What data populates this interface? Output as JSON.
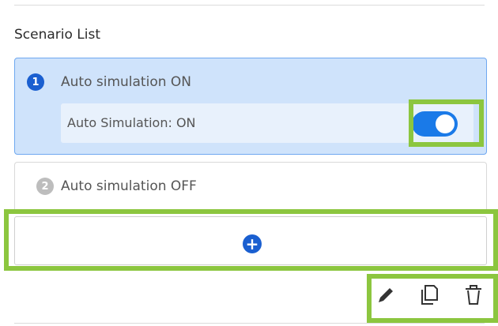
{
  "section_title": "Scenario List",
  "scenarios": [
    {
      "number": "1",
      "label": "Auto simulation ON",
      "selected": true,
      "setting_label": "Auto Simulation: ON",
      "toggle_on": true
    },
    {
      "number": "2",
      "label": "Auto simulation OFF",
      "selected": false
    }
  ],
  "add_icon": "plus-circle-icon",
  "actions": [
    "pencil-icon",
    "copy-icon",
    "trash-icon"
  ],
  "colors": {
    "accent": "#1a5fd0",
    "toggle": "#1a7ae8",
    "selected_bg": "#cfe3fb",
    "highlight": "#8cc63f"
  }
}
